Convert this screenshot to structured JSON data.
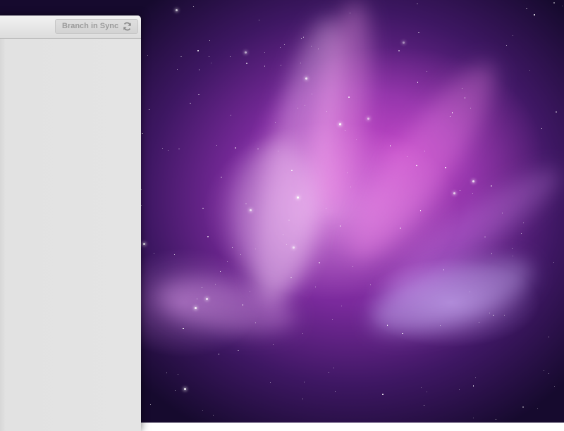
{
  "desktop": {
    "wallpaper": "aurora-wallpaper",
    "colors": {
      "deep_space": "#160a2e",
      "violet": "#7a2a9c",
      "magenta": "#c23ac8",
      "highlight": "#f2c4f2"
    }
  },
  "window": {
    "toolbar": {
      "sync_button": {
        "label": "Branch in Sync",
        "icon": "refresh-icon",
        "enabled": false
      }
    }
  }
}
